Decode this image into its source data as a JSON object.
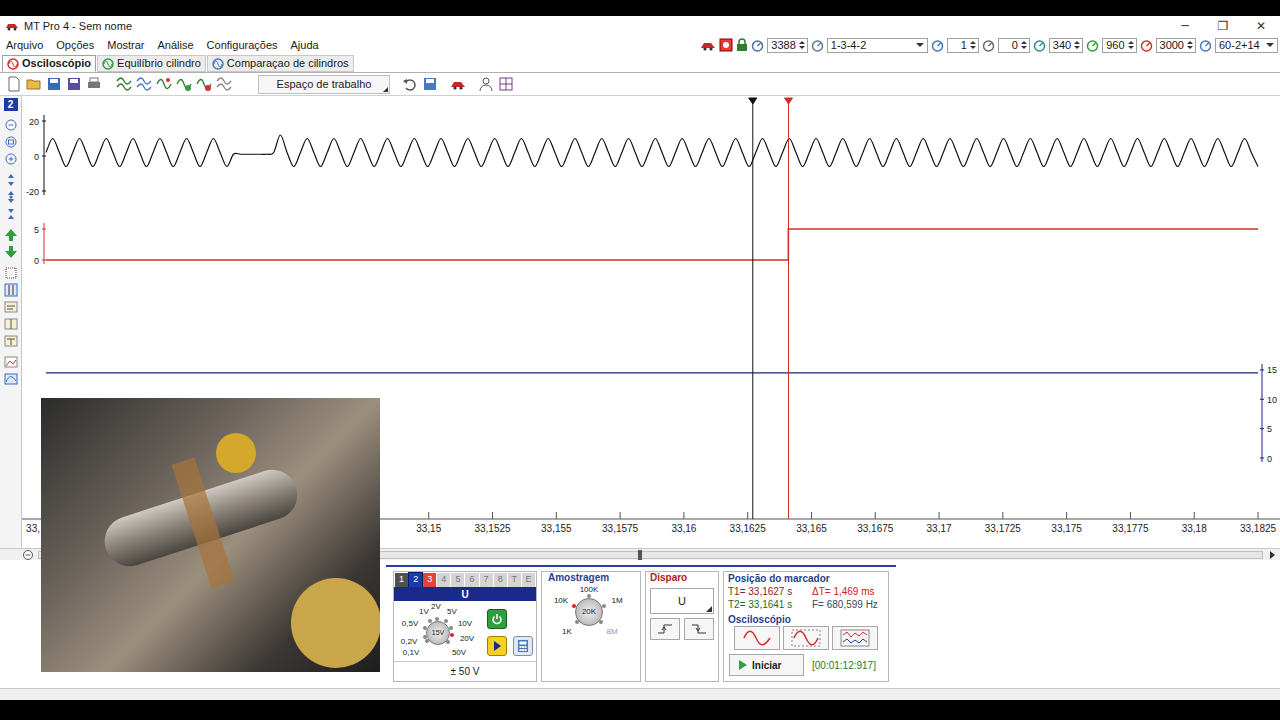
{
  "window": {
    "title": "MT Pro 4 - Sem nome",
    "controls": [
      "─",
      "❐",
      "✕"
    ]
  },
  "menu": [
    "Arquivo",
    "Opções",
    "Mostrar",
    "Análise",
    "Configurações",
    "Ajuda"
  ],
  "engine_controls": [
    {
      "value": "3388",
      "kind": "spin"
    },
    {
      "value": "1-3-4-2",
      "kind": "dropdown"
    },
    {
      "value": "1",
      "kind": "spin"
    },
    {
      "value": "0",
      "kind": "spin"
    },
    {
      "value": "340",
      "kind": "spin"
    },
    {
      "value": "960",
      "kind": "spin"
    },
    {
      "value": "3000",
      "kind": "spin"
    },
    {
      "value": "60-2+14",
      "kind": "dropdown"
    }
  ],
  "tabs": [
    {
      "label": "Osciloscópio",
      "selected": true
    },
    {
      "label": "Equilíbrio cilindro",
      "selected": false
    },
    {
      "label": "Comparaçao de cilindros",
      "selected": false
    }
  ],
  "toolbar": {
    "workspace": "Espaço de trabalho"
  },
  "side_toolbar": {
    "channel_badge": "2"
  },
  "chart": {
    "x_axis": {
      "min": 33.135,
      "max": 33.1825,
      "ticks": [
        {
          "label": "33,",
          "value": 33.135
        },
        {
          "label": "33,15",
          "value": 33.15
        },
        {
          "label": "33,1525",
          "value": 33.1525
        },
        {
          "label": "33,155",
          "value": 33.155
        },
        {
          "label": "33,1575",
          "value": 33.1575
        },
        {
          "label": "33,16",
          "value": 33.16
        },
        {
          "label": "33,1625",
          "value": 33.1625
        },
        {
          "label": "33,165",
          "value": 33.165
        },
        {
          "label": "33,1675",
          "value": 33.1675
        },
        {
          "label": "33,17",
          "value": 33.17
        },
        {
          "label": "33,1725",
          "value": 33.1725
        },
        {
          "label": "33,175",
          "value": 33.175
        },
        {
          "label": "33,1775",
          "value": 33.1775
        },
        {
          "label": "33,18",
          "value": 33.18
        },
        {
          "label": "33,1825",
          "value": 33.1825
        }
      ]
    },
    "series": [
      {
        "kind": "analog",
        "color": "#111111",
        "y_ticks": [
          {
            "label": "20",
            "value": 20
          },
          {
            "label": "0",
            "value": 0
          },
          {
            "label": "-20",
            "value": -20
          }
        ],
        "values": [
          2,
          10,
          2,
          -6,
          2,
          10,
          2,
          -6,
          2,
          10,
          2,
          -6,
          2,
          10,
          2,
          -6,
          2,
          10,
          2,
          -6,
          2,
          10,
          2,
          -6,
          2,
          10,
          2,
          -6,
          1,
          1,
          1,
          1,
          1,
          1,
          2,
          12,
          2,
          -6,
          2,
          10,
          2,
          -6,
          2,
          10,
          2,
          -6,
          2,
          10,
          2,
          -6,
          2,
          10,
          2,
          -6,
          2,
          10,
          2,
          -6,
          2,
          10,
          2,
          -6,
          2,
          10,
          2,
          -6,
          2,
          10,
          2,
          -6,
          2,
          10,
          2,
          -6,
          2,
          10,
          2,
          -6,
          2,
          10,
          2,
          -6,
          2,
          10,
          2,
          -6,
          2,
          10,
          2,
          -6,
          2,
          10,
          2,
          -6,
          2,
          10,
          2,
          -6,
          2,
          10,
          2,
          -6,
          2,
          10,
          2,
          -6,
          2,
          10,
          2,
          -6,
          2,
          10,
          2,
          -6,
          2,
          10,
          2,
          -6,
          2,
          10,
          2,
          -6,
          2,
          10,
          2,
          -6,
          2,
          10,
          2,
          -6,
          2,
          10,
          2,
          -6,
          2,
          10,
          2,
          -6,
          2,
          10,
          2,
          -6,
          2,
          10,
          2,
          -6,
          2,
          10,
          2,
          -6,
          2,
          10,
          2,
          -6,
          2,
          10,
          2,
          -6,
          2,
          10,
          2,
          -6,
          2,
          10,
          2,
          -6,
          2,
          10,
          2,
          -6,
          2,
          10,
          2,
          -6,
          2,
          10,
          2,
          -6,
          2,
          10,
          2,
          -6
        ]
      },
      {
        "kind": "digital",
        "color": "#d0302a",
        "y_ticks": [
          {
            "label": "5",
            "value": 5
          },
          {
            "label": "0",
            "value": 0
          }
        ],
        "values": [
          0,
          0,
          0,
          0,
          0,
          0,
          0,
          0,
          0,
          0,
          0,
          0,
          0,
          0,
          0,
          0,
          0,
          0,
          0,
          0,
          0,
          0,
          0,
          0,
          0,
          0,
          0,
          0,
          0,
          0,
          0,
          0,
          0,
          0,
          0,
          0,
          0,
          0,
          0,
          0,
          0,
          0,
          0,
          0,
          0,
          0,
          0,
          0,
          0,
          5,
          5,
          5,
          5,
          5,
          5,
          5,
          5,
          5,
          5,
          5,
          5,
          5,
          5,
          5,
          5,
          5,
          5,
          5,
          5,
          5,
          5,
          5,
          5,
          5,
          5,
          5,
          5,
          5,
          5,
          5
        ]
      },
      {
        "kind": "analog",
        "color": "#1a237e",
        "y_ticks": [
          {
            "label": "15",
            "value": 15
          },
          {
            "label": "10",
            "value": 10
          },
          {
            "label": "5",
            "value": 5
          },
          {
            "label": "0",
            "value": 0
          }
        ],
        "values": [
          14.5,
          14.5,
          14.5,
          14.5,
          14.5,
          14.5,
          14.5,
          14.5,
          14.5,
          14.5,
          14.5,
          14.5,
          14.5,
          14.5,
          14.5,
          14.5,
          14.5,
          14.5,
          14.5,
          14.5
        ]
      }
    ],
    "cursors": [
      {
        "time": 33.1627,
        "color": "#111111"
      },
      {
        "time": 33.1641,
        "color": "#d0302a"
      }
    ]
  },
  "scrollbar": {
    "level": 0.49
  },
  "channel_panel": {
    "channels": [
      {
        "label": "1",
        "selected": false,
        "color": "#505050"
      },
      {
        "label": "2",
        "selected": true,
        "color": "#1c3aa9"
      },
      {
        "label": "3",
        "selected": false,
        "color": "#e0443c"
      },
      {
        "label": "4",
        "selected": false,
        "color": "#d4d4d4"
      },
      {
        "label": "5",
        "selected": false,
        "color": "#d4d4d4"
      },
      {
        "label": "6",
        "selected": false,
        "color": "#d4d4d4"
      },
      {
        "label": "7",
        "selected": false,
        "color": "#d4d4d4"
      },
      {
        "label": "8",
        "selected": false,
        "color": "#d4d4d4"
      },
      {
        "label": "T",
        "selected": false,
        "color": "#d4d4d4"
      },
      {
        "label": "E",
        "selected": false,
        "color": "#d4d4d4"
      }
    ],
    "input": "U",
    "ranges": [
      {
        "label": "0,1V",
        "selected": false
      },
      {
        "label": "0,2V",
        "selected": false
      },
      {
        "label": "0,5V",
        "selected": false
      },
      {
        "label": "1V",
        "selected": false
      },
      {
        "label": "2V",
        "selected": false
      },
      {
        "label": "5V",
        "selected": false
      },
      {
        "label": "10V",
        "selected": false
      },
      {
        "label": "20V",
        "selected": true
      },
      {
        "label": "50V",
        "selected": false
      }
    ],
    "range_value": "15V",
    "scale": "± 50 V"
  },
  "sampling": {
    "title": "Amostragem",
    "value": "20K",
    "rates": [
      {
        "label": "1K",
        "selected": false,
        "disabled": false
      },
      {
        "label": "10K",
        "selected": true,
        "disabled": false
      },
      {
        "label": "100K",
        "selected": false,
        "disabled": false
      },
      {
        "label": "1M",
        "selected": false,
        "disabled": false
      },
      {
        "label": "8M",
        "selected": false,
        "disabled": true
      }
    ]
  },
  "trigger": {
    "title": "Disparo",
    "source": "U"
  },
  "markers": {
    "title": "Posição do marcador",
    "readings": [
      {
        "text": "T1= 33,1627 s",
        "color": "#8a1c2c"
      },
      {
        "text": "ΔT= 1,469 ms",
        "color": "#d02020"
      },
      {
        "text": "T2= 33,1641 s",
        "color": "#1f6b2a"
      },
      {
        "text": "F= 680,599 Hz",
        "color": "#3a4a5a"
      }
    ]
  },
  "oscilloscope": {
    "title": "Osciloscópio",
    "start": "Iniciar",
    "timer": "[00:01:12:917]"
  }
}
